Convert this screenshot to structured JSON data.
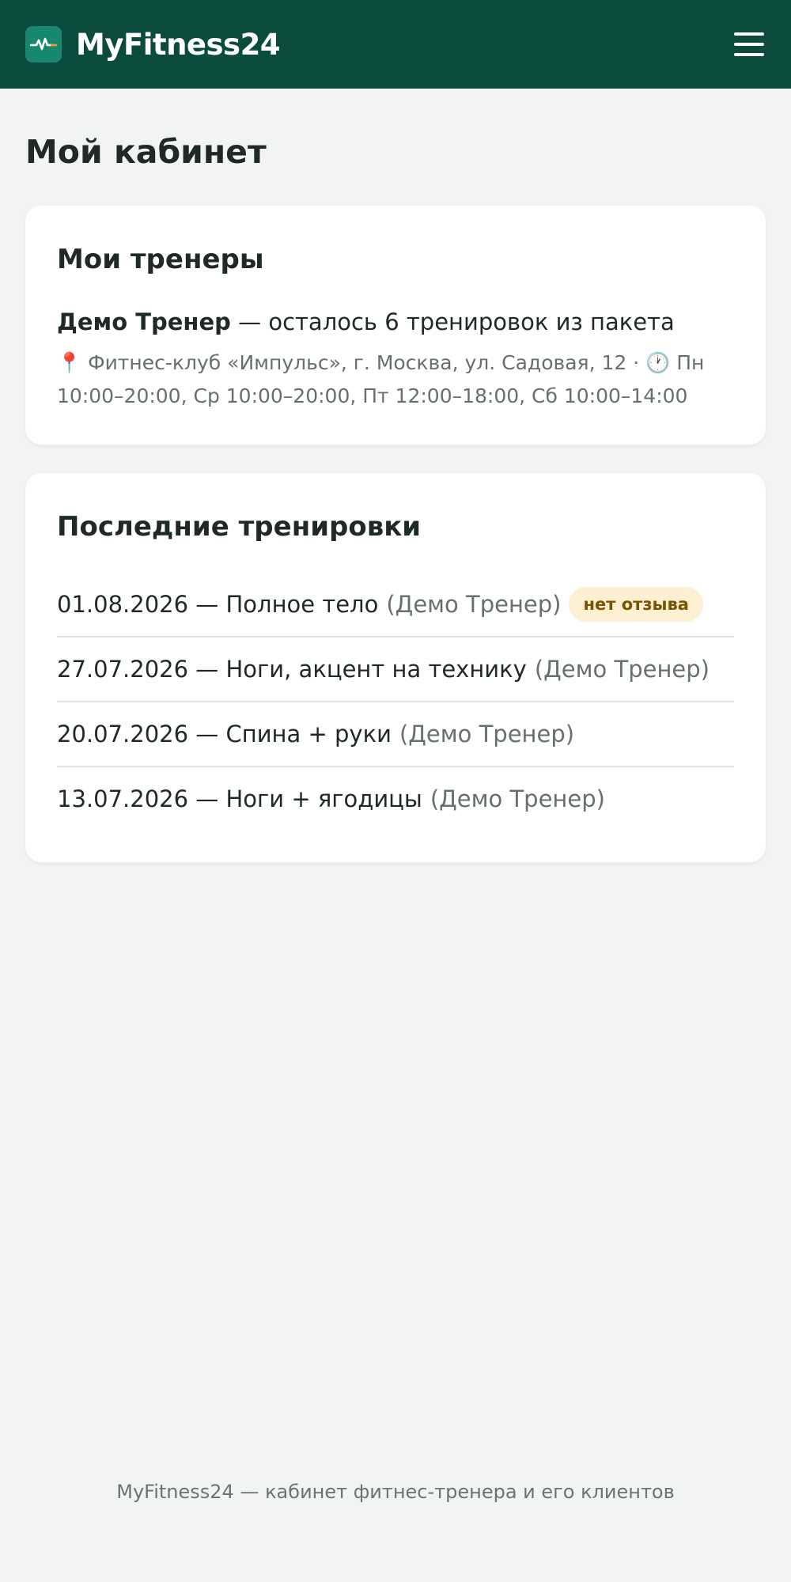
{
  "header": {
    "app_name": "MyFitness24",
    "logo_icon": "heartbeat-icon",
    "menu_icon": "hamburger-menu-icon"
  },
  "page": {
    "title": "Мой кабинет"
  },
  "trainers_card": {
    "title": "Мои тренеры",
    "trainer_name": "Демо Тренер",
    "trainer_status": " — осталось 6 тренировок из пакета",
    "pin_icon": "📍",
    "location": " Фитнес-клуб «Импульс», г. Москва, ул. Садовая, 12 · ",
    "clock_icon": "🕐",
    "schedule": " Пн 10:00–20:00, Ср 10:00–20:00, Пт 12:00–18:00, Сб 10:00–14:00"
  },
  "workouts_card": {
    "title": "Последние тренировки",
    "items": [
      {
        "text": "01.08.2026 — Полное тело",
        "trainer": "(Демо Тренер)",
        "badge": "нет отзыва"
      },
      {
        "text": "27.07.2026 — Ноги, акцент на технику",
        "trainer": "(Демо Тренер)"
      },
      {
        "text": "20.07.2026 — Спина + руки",
        "trainer": "(Демо Тренер)"
      },
      {
        "text": "13.07.2026 — Ноги + ягодицы",
        "trainer": "(Демо Тренер)"
      }
    ]
  },
  "footer": {
    "text": "MyFitness24 — кабинет фитнес-тренера и его клиентов"
  },
  "colors": {
    "header_bg": "#0b4b3e",
    "logo_bg": "#17886d",
    "page_bg": "#f2f4f3",
    "badge_bg": "#fdf0d2",
    "badge_text": "#7a5300"
  }
}
